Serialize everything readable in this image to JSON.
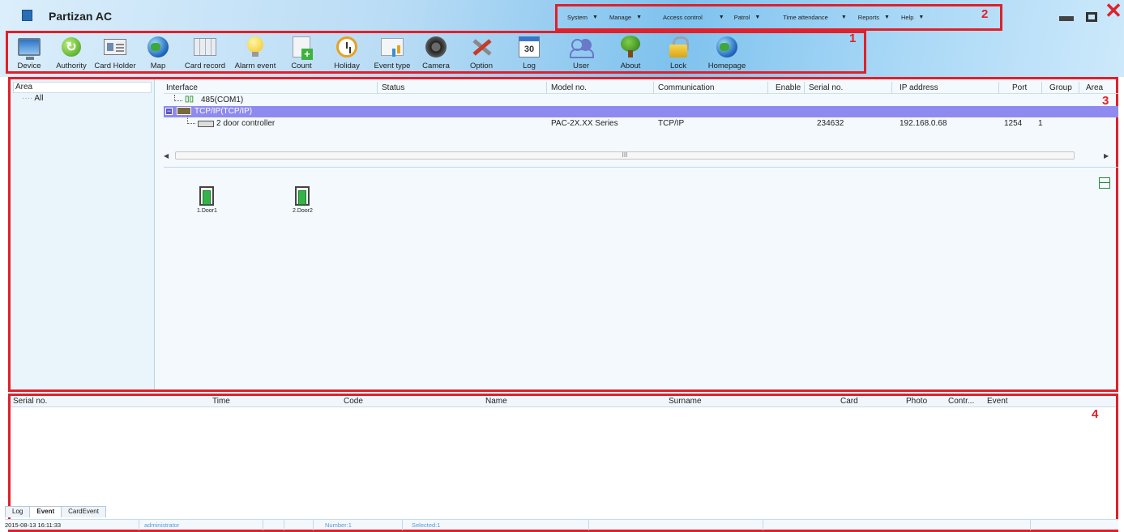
{
  "app": {
    "title": "Partizan AC"
  },
  "menu": [
    "System",
    "Manage",
    "Access control",
    "Patrol",
    "Time attendance",
    "Reports",
    "Help"
  ],
  "annotations": {
    "toolbar": "1",
    "menubar": "2",
    "device_panel": "3",
    "event_panel": "4"
  },
  "toolbar": [
    {
      "label": "Device",
      "icon": "monitor-icon"
    },
    {
      "label": "Authority",
      "icon": "refresh-icon"
    },
    {
      "label": "Card Holder",
      "icon": "id-card-icon"
    },
    {
      "label": "Map",
      "icon": "globe-icon"
    },
    {
      "label": "Card record",
      "icon": "grid-icon"
    },
    {
      "label": "Alarm event",
      "icon": "bulb-icon"
    },
    {
      "label": "Count",
      "icon": "add-document-icon"
    },
    {
      "label": "Holiday",
      "icon": "alarm-clock-icon"
    },
    {
      "label": "Event type",
      "icon": "chart-icon"
    },
    {
      "label": "Camera",
      "icon": "camera-icon"
    },
    {
      "label": "Option",
      "icon": "tools-icon"
    },
    {
      "label": "Log",
      "icon": "calendar-icon",
      "badge": "30"
    },
    {
      "label": "User",
      "icon": "users-icon"
    },
    {
      "label": "About",
      "icon": "tree-icon"
    },
    {
      "label": "Lock",
      "icon": "padlock-icon"
    },
    {
      "label": "Homepage",
      "icon": "globe-icon"
    }
  ],
  "area_tree": {
    "header": "Area",
    "items": [
      "All"
    ]
  },
  "device_grid": {
    "columns": [
      "Interface",
      "Status",
      "Model no.",
      "Communication",
      "Enable",
      "Serial no.",
      "IP address",
      "Port",
      "Group",
      "Area"
    ],
    "rows": [
      {
        "interface": "485(COM1)"
      },
      {
        "interface": "TCP/IP(TCP/IP)"
      },
      {
        "interface": "2 door controller",
        "model": "PAC-2X.XX Series",
        "communication": "TCP/IP",
        "serial": "234632",
        "ip": "192.168.0.68",
        "port": "1254",
        "group": "1"
      }
    ],
    "scroll_label": "III"
  },
  "doors": [
    "1.Door1",
    "2.Door2"
  ],
  "event_grid": {
    "columns": [
      "Serial no.",
      "Time",
      "Code",
      "Name",
      "Surname",
      "Card",
      "Photo",
      "Contr...",
      "Event"
    ]
  },
  "tabs": [
    "Log",
    "Event",
    "CardEvent"
  ],
  "active_tab": "Event",
  "status": {
    "datetime": "2015-08-13 16:11:33",
    "user": "administrator",
    "number": "Number:1",
    "selected": "Selected:1"
  },
  "colors": {
    "annotation": "#e0202a",
    "selected_row": "#8f8af0"
  }
}
